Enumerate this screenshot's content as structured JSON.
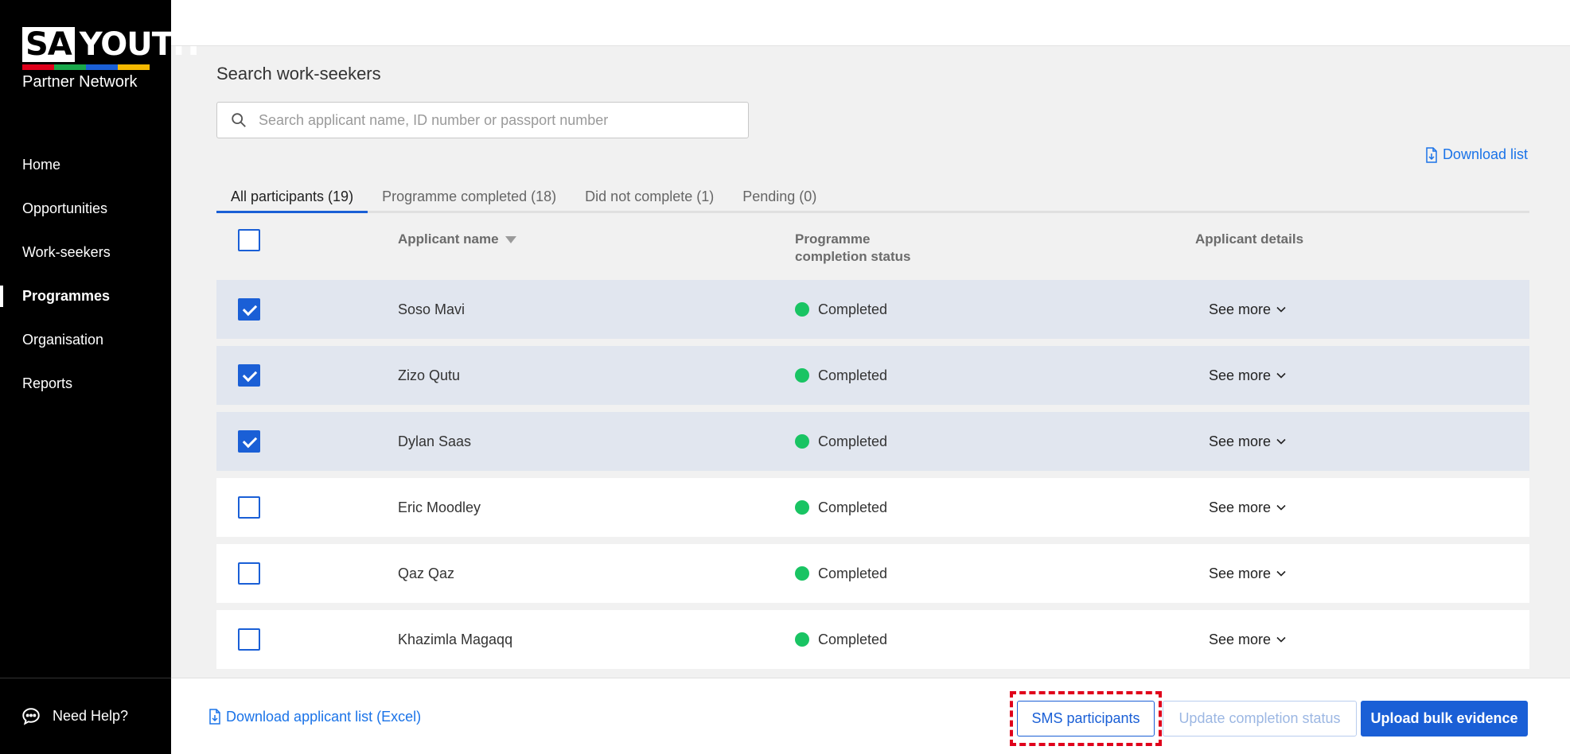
{
  "brand": {
    "sa": "SA",
    "youth": "YOUTH",
    "subtitle": "Partner Network",
    "stripe_colors": [
      "#e0001b",
      "#19a84b",
      "#1a5fd6",
      "#f5b800"
    ]
  },
  "sidebar": {
    "items": [
      {
        "label": "Home",
        "active": false
      },
      {
        "label": "Opportunities",
        "active": false
      },
      {
        "label": "Work-seekers",
        "active": false
      },
      {
        "label": "Programmes",
        "active": true
      },
      {
        "label": "Organisation",
        "active": false
      },
      {
        "label": "Reports",
        "active": false
      }
    ],
    "help_label": "Need Help?"
  },
  "main": {
    "title": "Search work-seekers",
    "search_placeholder": "Search applicant name, ID number or passport number",
    "download_list": "Download list",
    "tabs": [
      {
        "label": "All participants (19)",
        "active": true
      },
      {
        "label": "Programme completed (18)",
        "active": false
      },
      {
        "label": "Did not complete (1)",
        "active": false
      },
      {
        "label": "Pending (0)",
        "active": false
      }
    ],
    "columns": {
      "name": "Applicant name",
      "status_line1": "Programme",
      "status_line2": "completion status",
      "details": "Applicant details"
    },
    "rows": [
      {
        "name": "Soso Mavi",
        "status": "Completed",
        "more": "See more",
        "checked": true
      },
      {
        "name": "Zizo Qutu",
        "status": "Completed",
        "more": "See more",
        "checked": true
      },
      {
        "name": "Dylan Saas",
        "status": "Completed",
        "more": "See more",
        "checked": true
      },
      {
        "name": "Eric Moodley",
        "status": "Completed",
        "more": "See more",
        "checked": false
      },
      {
        "name": "Qaz Qaz",
        "status": "Completed",
        "more": "See more",
        "checked": false
      },
      {
        "name": "Khazimla Magaqq",
        "status": "Completed",
        "more": "See more",
        "checked": false
      }
    ]
  },
  "footer": {
    "download_excel": "Download applicant list (Excel)",
    "sms_button": "SMS participants",
    "update_button": "Update completion status",
    "upload_button": "Upload bulk evidence"
  },
  "colors": {
    "accent": "#1a5fd6",
    "status_completed": "#19c463",
    "highlight": "#e0001b"
  }
}
